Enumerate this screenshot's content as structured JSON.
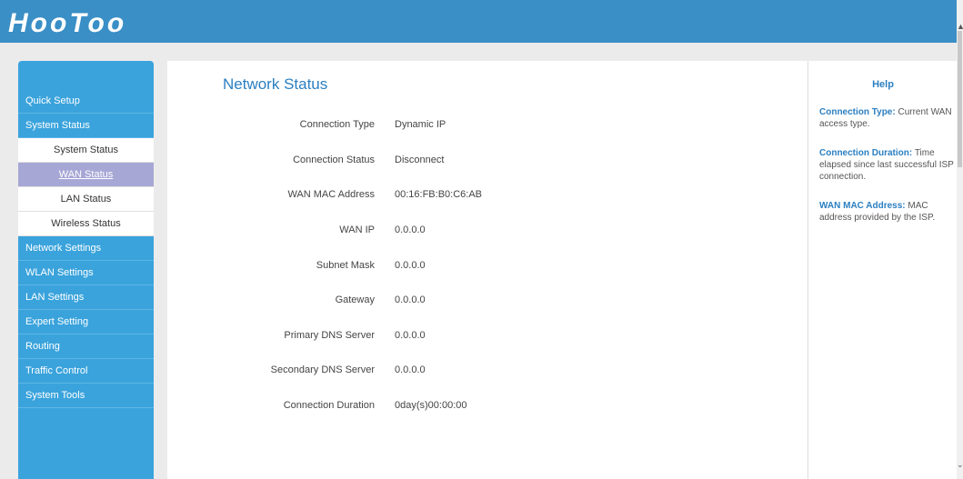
{
  "header": {
    "logo_text": "HooToo",
    "bg_color": "#3a8fc6"
  },
  "sidebar": {
    "items": [
      {
        "label": "Quick Setup",
        "level": 1
      },
      {
        "label": "System Status",
        "level": 1
      },
      {
        "label": "System Status",
        "level": 2
      },
      {
        "label": "WAN Status",
        "level": 2,
        "active": true
      },
      {
        "label": "LAN Status",
        "level": 2
      },
      {
        "label": "Wireless Status",
        "level": 2
      },
      {
        "label": "Network Settings",
        "level": 1
      },
      {
        "label": "WLAN Settings",
        "level": 1
      },
      {
        "label": "LAN Settings",
        "level": 1
      },
      {
        "label": "Expert Setting",
        "level": 1
      },
      {
        "label": "Routing",
        "level": 1
      },
      {
        "label": "Traffic Control",
        "level": 1
      },
      {
        "label": "System Tools",
        "level": 1
      }
    ],
    "bg_color": "#3aa3dc",
    "active_color": "#a7a7d6"
  },
  "main": {
    "title": "Network Status",
    "rows": [
      {
        "label": "Connection Type",
        "value": "Dynamic IP"
      },
      {
        "label": "Connection Status",
        "value": "Disconnect"
      },
      {
        "label": "WAN MAC Address",
        "value": "00:16:FB:B0:C6:AB"
      },
      {
        "label": "WAN IP",
        "value": "0.0.0.0"
      },
      {
        "label": "Subnet Mask",
        "value": "0.0.0.0"
      },
      {
        "label": "Gateway",
        "value": "0.0.0.0"
      },
      {
        "label": "Primary DNS Server",
        "value": "0.0.0.0"
      },
      {
        "label": "Secondary DNS Server",
        "value": "0.0.0.0"
      },
      {
        "label": "Connection Duration",
        "value": "0day(s)00:00:00"
      }
    ]
  },
  "help": {
    "title": "Help",
    "entries": [
      {
        "term": "Connection Type:",
        "text": " Current WAN access type."
      },
      {
        "term": "Connection Duration:",
        "text": " Time elapsed since last successful ISP connection."
      },
      {
        "term": "WAN MAC Address:",
        "text": " MAC address provided by the ISP."
      }
    ]
  },
  "scrollbar": {
    "up_icon": "▲",
    "down_icon": "⌄"
  }
}
